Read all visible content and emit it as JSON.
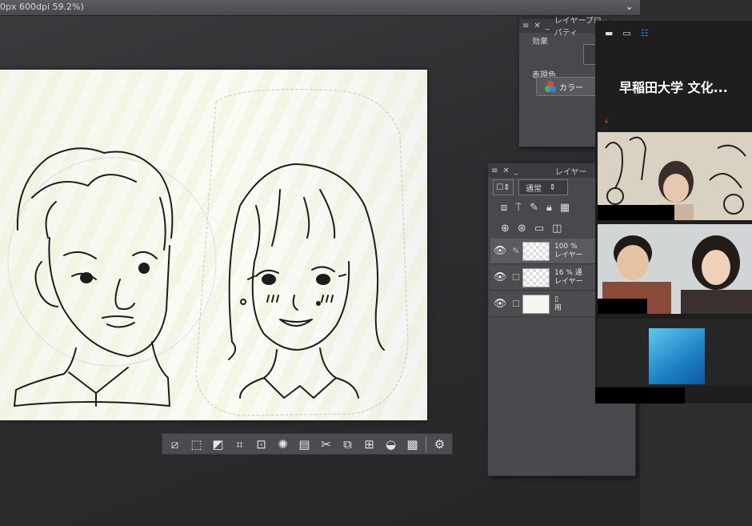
{
  "title_bar": {
    "document_title": "0px 600dpi 59.2%)",
    "collapse_icon": "chevron-down-icon"
  },
  "color_panel": {
    "effect_label": "効果",
    "expression_label": "表現色",
    "color_mode_label": "カラー",
    "header_title": "レイヤープロパティ"
  },
  "layer_panel": {
    "header_title": "レイヤー",
    "blend_mode": "通常",
    "layers": [
      {
        "opacity": "100 %",
        "name": "レイヤー",
        "selected": true
      },
      {
        "opacity": "16 % 通",
        "name": "レイヤー",
        "selected": false
      },
      {
        "opacity": "",
        "name": "用",
        "selected": false
      }
    ]
  },
  "selection_toolbar": {
    "buttons": [
      "deselect-icon",
      "select-all-icon",
      "invert-selection-icon",
      "crop-icon",
      "expand-selection-icon",
      "shrink-selection-icon",
      "clear-icon",
      "cut-icon",
      "copy-paste-icon",
      "transform-icon",
      "fill-icon",
      "pattern-icon",
      "settings-icon"
    ]
  },
  "video_call": {
    "meeting_title": "早稲田大学 文化...",
    "tiles": [
      "participant-1",
      "participant-2",
      "participant-3"
    ]
  }
}
